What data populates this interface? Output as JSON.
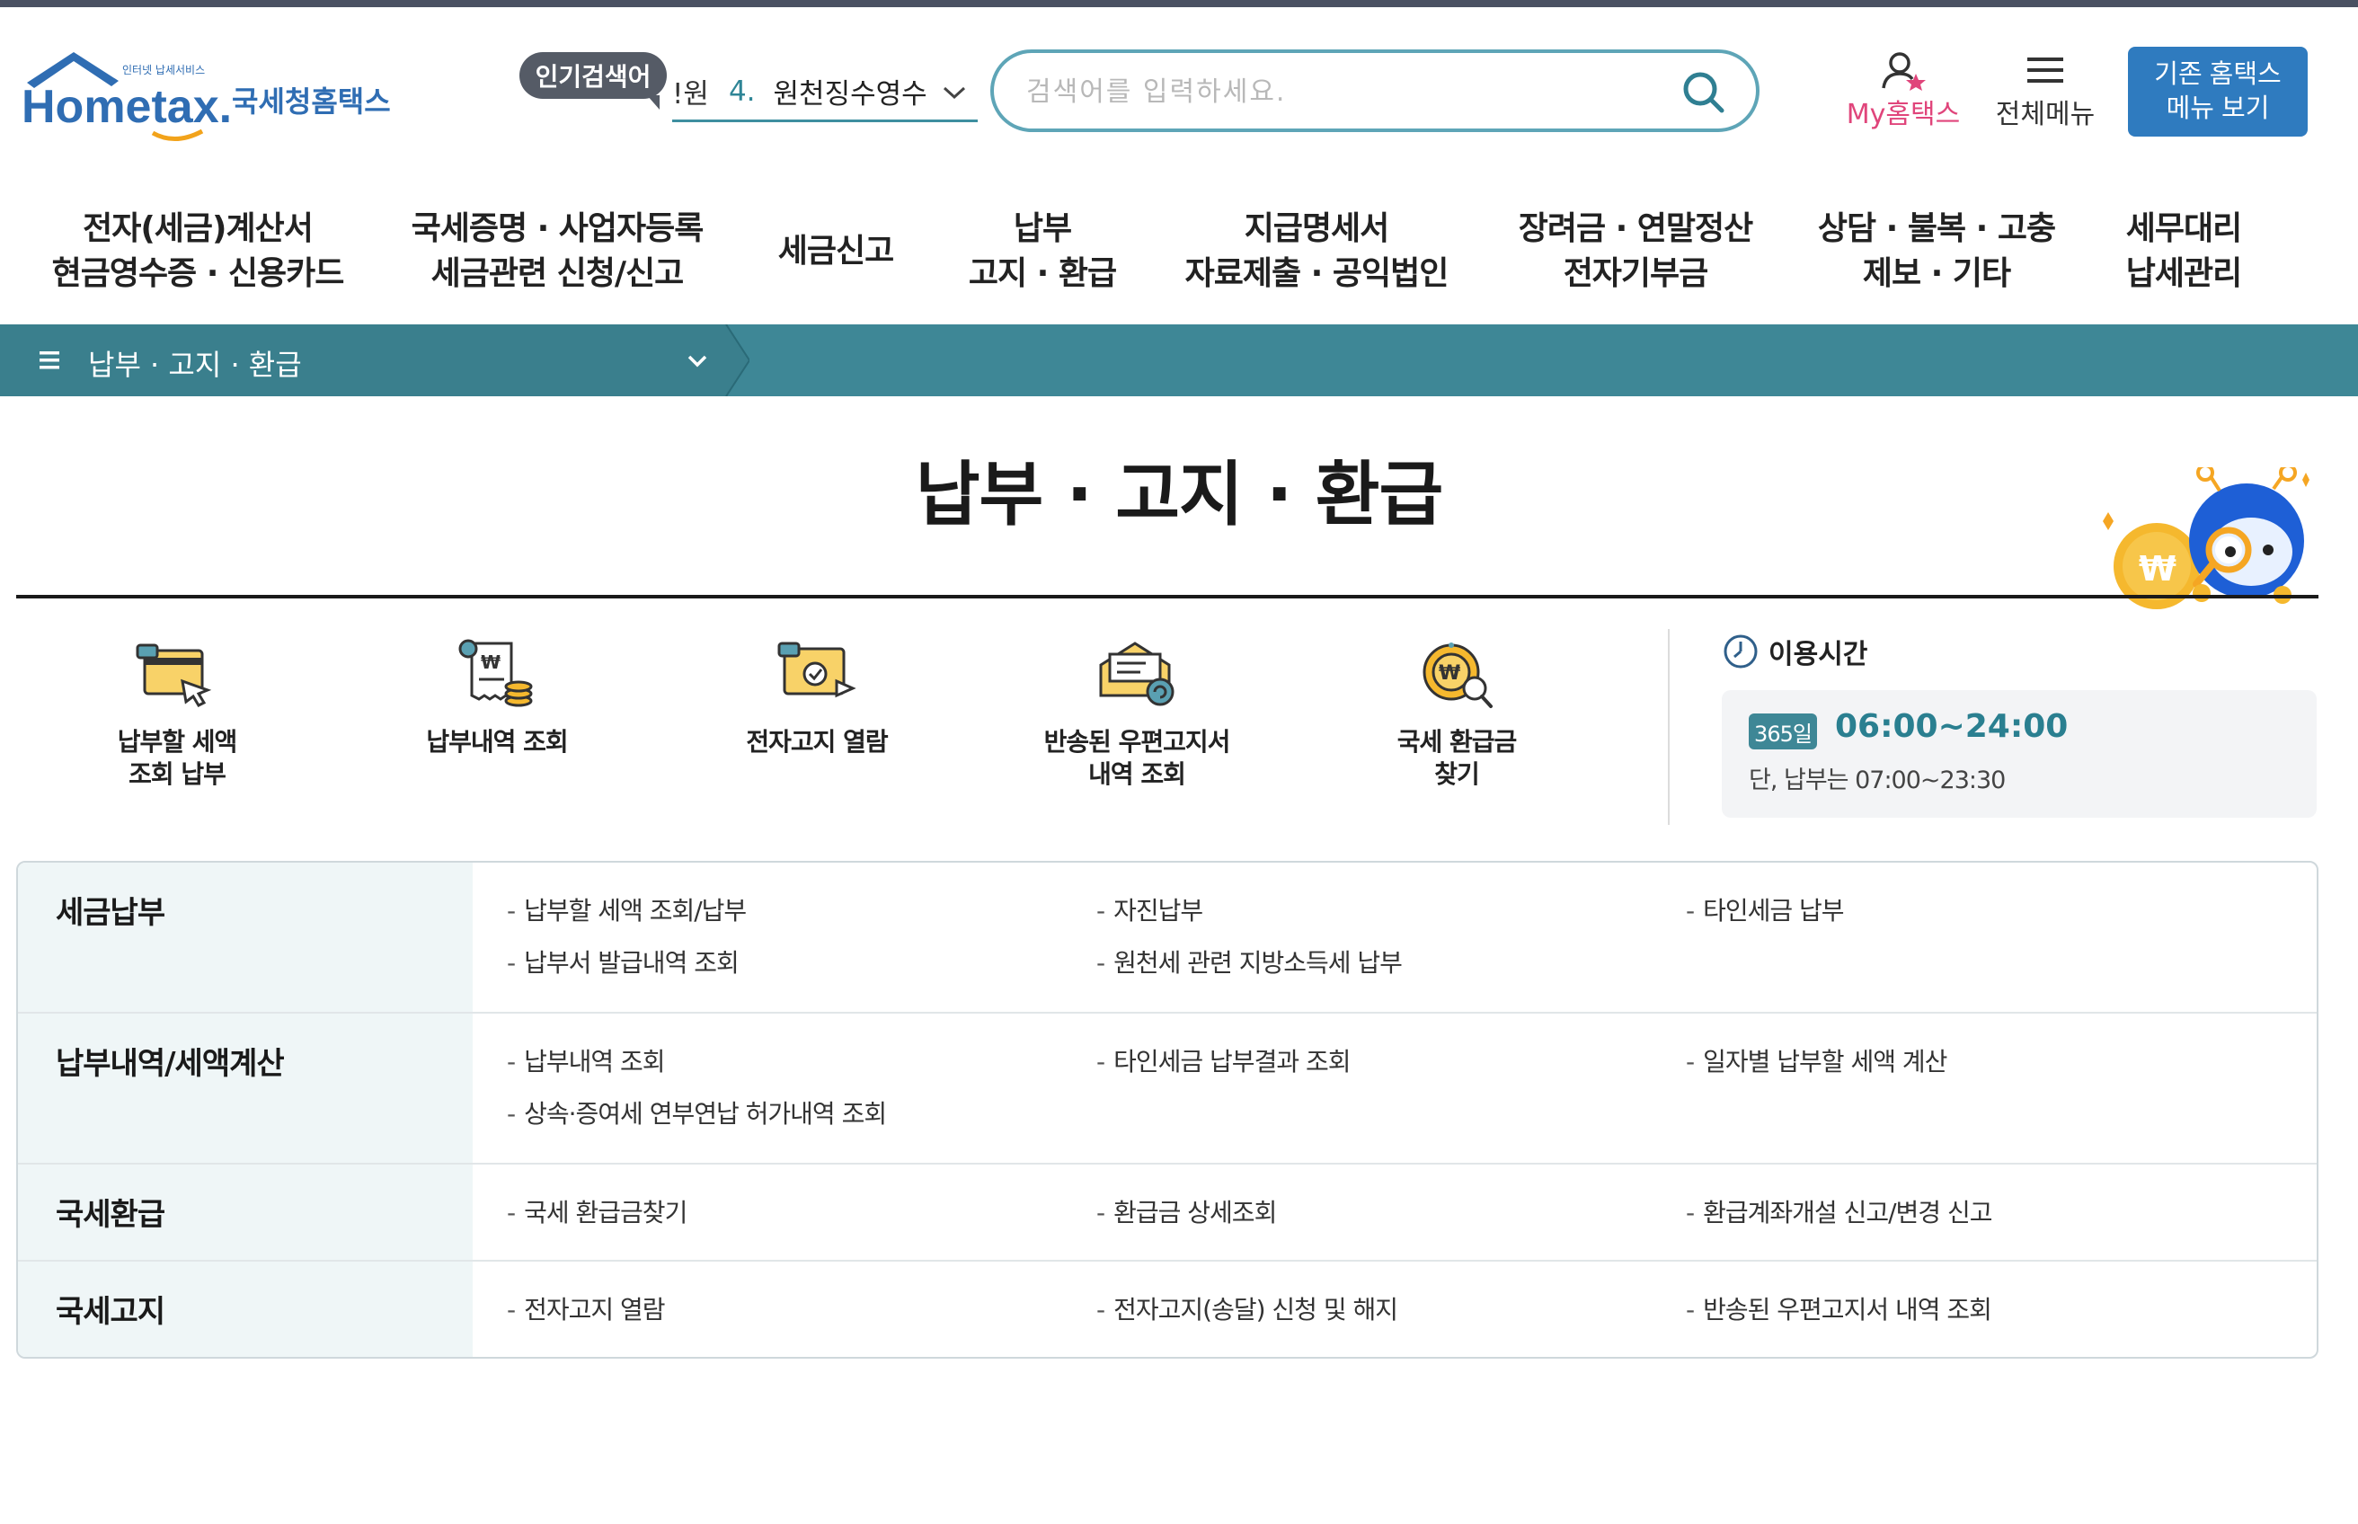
{
  "header": {
    "logo_text": "Hometax.",
    "logo_brand": "국세청홈택스",
    "logo_tagline": "인터넷 납세서비스",
    "popular_badge": "인기검색어",
    "popular_prefix": "!원",
    "popular_rank": "4.",
    "popular_keyword": "원천징수영수",
    "search_placeholder": "검색어를 입력하세요.",
    "my_hometax": "My홈택스",
    "all_menu": "전체메뉴",
    "legacy_button": "기존 홈택스\n메뉴 보기"
  },
  "gnb": [
    {
      "label": "전자(세금)계산서\n현금영수증 · 신용카드"
    },
    {
      "label": "국세증명 · 사업자등록\n세금관련 신청/신고"
    },
    {
      "label": "세금신고"
    },
    {
      "label": "납부\n고지 · 환급"
    },
    {
      "label": "지급명세서\n자료제출 · 공익법인"
    },
    {
      "label": "장려금 · 연말정산\n전자기부금"
    },
    {
      "label": "상담 · 불복 · 고충\n제보 · 기타"
    },
    {
      "label": "세무대리\n납세관리"
    }
  ],
  "breadcrumb": {
    "current": "납부 · 고지 · 환급"
  },
  "page_title": "납부 · 고지 · 환급",
  "quick_menu": [
    {
      "label": "납부할 세액\n조회 납부",
      "icon": "card-payment-icon"
    },
    {
      "label": "납부내역 조회",
      "icon": "receipt-coins-icon"
    },
    {
      "label": "전자고지 열람",
      "icon": "e-notice-icon"
    },
    {
      "label": "반송된 우편고지서\n내역 조회",
      "icon": "returned-mail-icon"
    },
    {
      "label": "국세 환급금\n찾기",
      "icon": "refund-search-icon"
    }
  ],
  "hours": {
    "heading": "이용시간",
    "badge": "365일",
    "time": "06:00~24:00",
    "note": "단, 납부는 07:00~23:30"
  },
  "menu_table": [
    {
      "head": "세금납부",
      "links": [
        "납부할 세액 조회/납부",
        "자진납부",
        "타인세금 납부",
        "납부서 발급내역 조회",
        "원천세 관련 지방소득세 납부"
      ]
    },
    {
      "head": "납부내역/세액계산",
      "links": [
        "납부내역 조회",
        "타인세금 납부결과 조회",
        "일자별 납부할 세액 계산",
        "상속·증여세 연부연납 허가내역 조회"
      ]
    },
    {
      "head": "국세환급",
      "links": [
        "국세 환급금찾기",
        "환급금 상세조회",
        "환급계좌개설 신고/변경 신고"
      ]
    },
    {
      "head": "국세고지",
      "links": [
        "전자고지 열람",
        "전자고지(송달) 신청 및 해지",
        "반송된 우편고지서 내역 조회"
      ]
    }
  ],
  "colors": {
    "teal": "#3e8796",
    "brand_blue": "#2f7bbf",
    "pink": "#e0457b",
    "search_border": "#5ea5b7"
  }
}
